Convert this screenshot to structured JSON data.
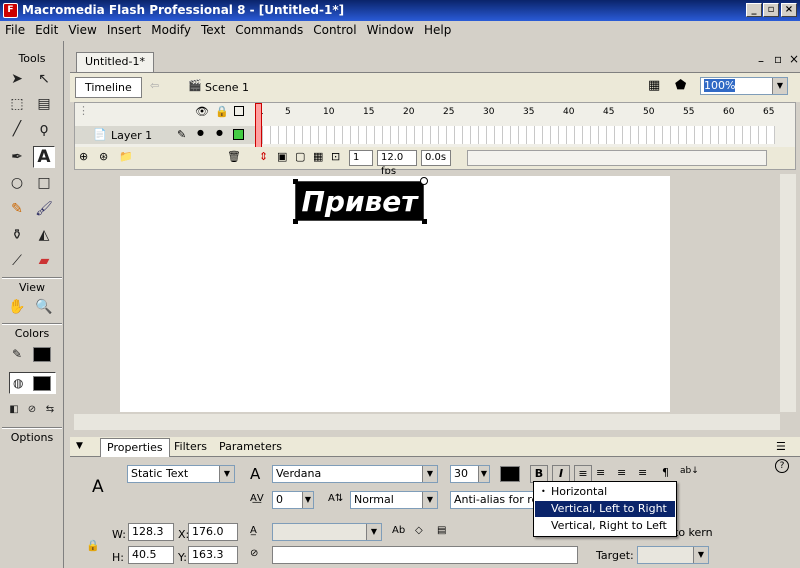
{
  "titlebar": {
    "title": "Macromedia Flash Professional 8 - [Untitled-1*]",
    "app_icon": "F"
  },
  "menu": [
    "File",
    "Edit",
    "View",
    "Insert",
    "Modify",
    "Text",
    "Commands",
    "Control",
    "Window",
    "Help"
  ],
  "tools": {
    "header": "Tools",
    "view_header": "View",
    "colors_header": "Colors",
    "options_header": "Options"
  },
  "document": {
    "tab": "Untitled-1*",
    "timeline_button": "Timeline",
    "scene": "Scene 1",
    "zoom": "100%"
  },
  "timeline": {
    "frame_numbers": [
      "1",
      "5",
      "10",
      "15",
      "20",
      "25",
      "30",
      "35",
      "40",
      "45",
      "50",
      "55",
      "60",
      "65"
    ],
    "layer": "Layer 1",
    "current_frame": "1",
    "fps": "12.0 fps",
    "time": "0.0s"
  },
  "stage": {
    "text": "Привет"
  },
  "properties": {
    "tabs": [
      "Properties",
      "Filters",
      "Parameters"
    ],
    "text_type": "Static Text",
    "font": "Verdana",
    "size": "30",
    "letter_spacing": "0",
    "baseline": "Normal",
    "antialias": "Anti-alias for rea",
    "w_label": "W:",
    "w": "128.3",
    "x_label": "X:",
    "x": "176.0",
    "h_label": "H:",
    "h": "40.5",
    "y_label": "Y:",
    "y": "163.3",
    "target_label": "Target:",
    "kern_label": "to kern",
    "bold": "B",
    "italic": "I"
  },
  "orientation_menu": {
    "items": [
      "Horizontal",
      "Vertical, Left to Right",
      "Vertical, Right to Left"
    ],
    "selected_index": 1
  }
}
